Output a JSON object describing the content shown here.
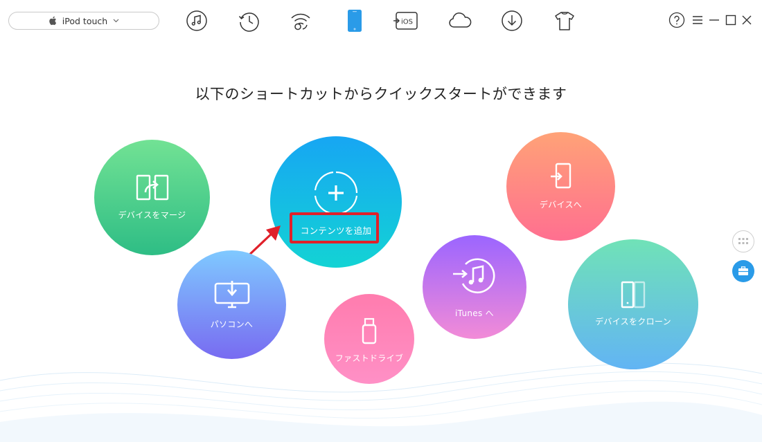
{
  "device": {
    "name": "iPod touch",
    "icon": "apple-icon",
    "dropdown_icon": "chevron-down-icon"
  },
  "toolbar": {
    "items": [
      {
        "name": "music-icon"
      },
      {
        "name": "history-icon"
      },
      {
        "name": "airbackup-icon"
      },
      {
        "name": "device-icon",
        "active": true
      },
      {
        "name": "ios-mover-icon",
        "label": "iOS"
      },
      {
        "name": "icloud-icon"
      },
      {
        "name": "download-icon"
      },
      {
        "name": "tshirt-icon"
      }
    ]
  },
  "window_controls": [
    "help-icon",
    "menu-icon",
    "minimize-icon",
    "maximize-icon",
    "close-icon"
  ],
  "headline": "以下のショートカットからクイックスタートができます",
  "shortcuts": {
    "merge": "デバイスをマージ",
    "add_content": "コンテンツを追加",
    "to_device": "デバイスへ",
    "to_pc": "パソコンへ",
    "flash_drive": "ファストドライブ",
    "to_itunes": "iTunes へ",
    "clone": "デバイスをクローン"
  },
  "colors": {
    "accent_blue": "#2a9be8",
    "highlight_red": "#e0202a",
    "merge": [
      "#6fe08f",
      "#2fbf86"
    ],
    "add_content": [
      "#1aa8f2",
      "#14d0d6"
    ],
    "to_device": [
      "#ffa07a",
      "#ff6f8e"
    ],
    "to_pc": [
      "#7ec8ff",
      "#7a6df0"
    ],
    "flash_drive": [
      "#ff7fb0",
      "#ff8fc4"
    ],
    "to_itunes": [
      "#9a66ff",
      "#f08ad8"
    ],
    "clone": [
      "#6ee0b9",
      "#64b6f2"
    ]
  }
}
